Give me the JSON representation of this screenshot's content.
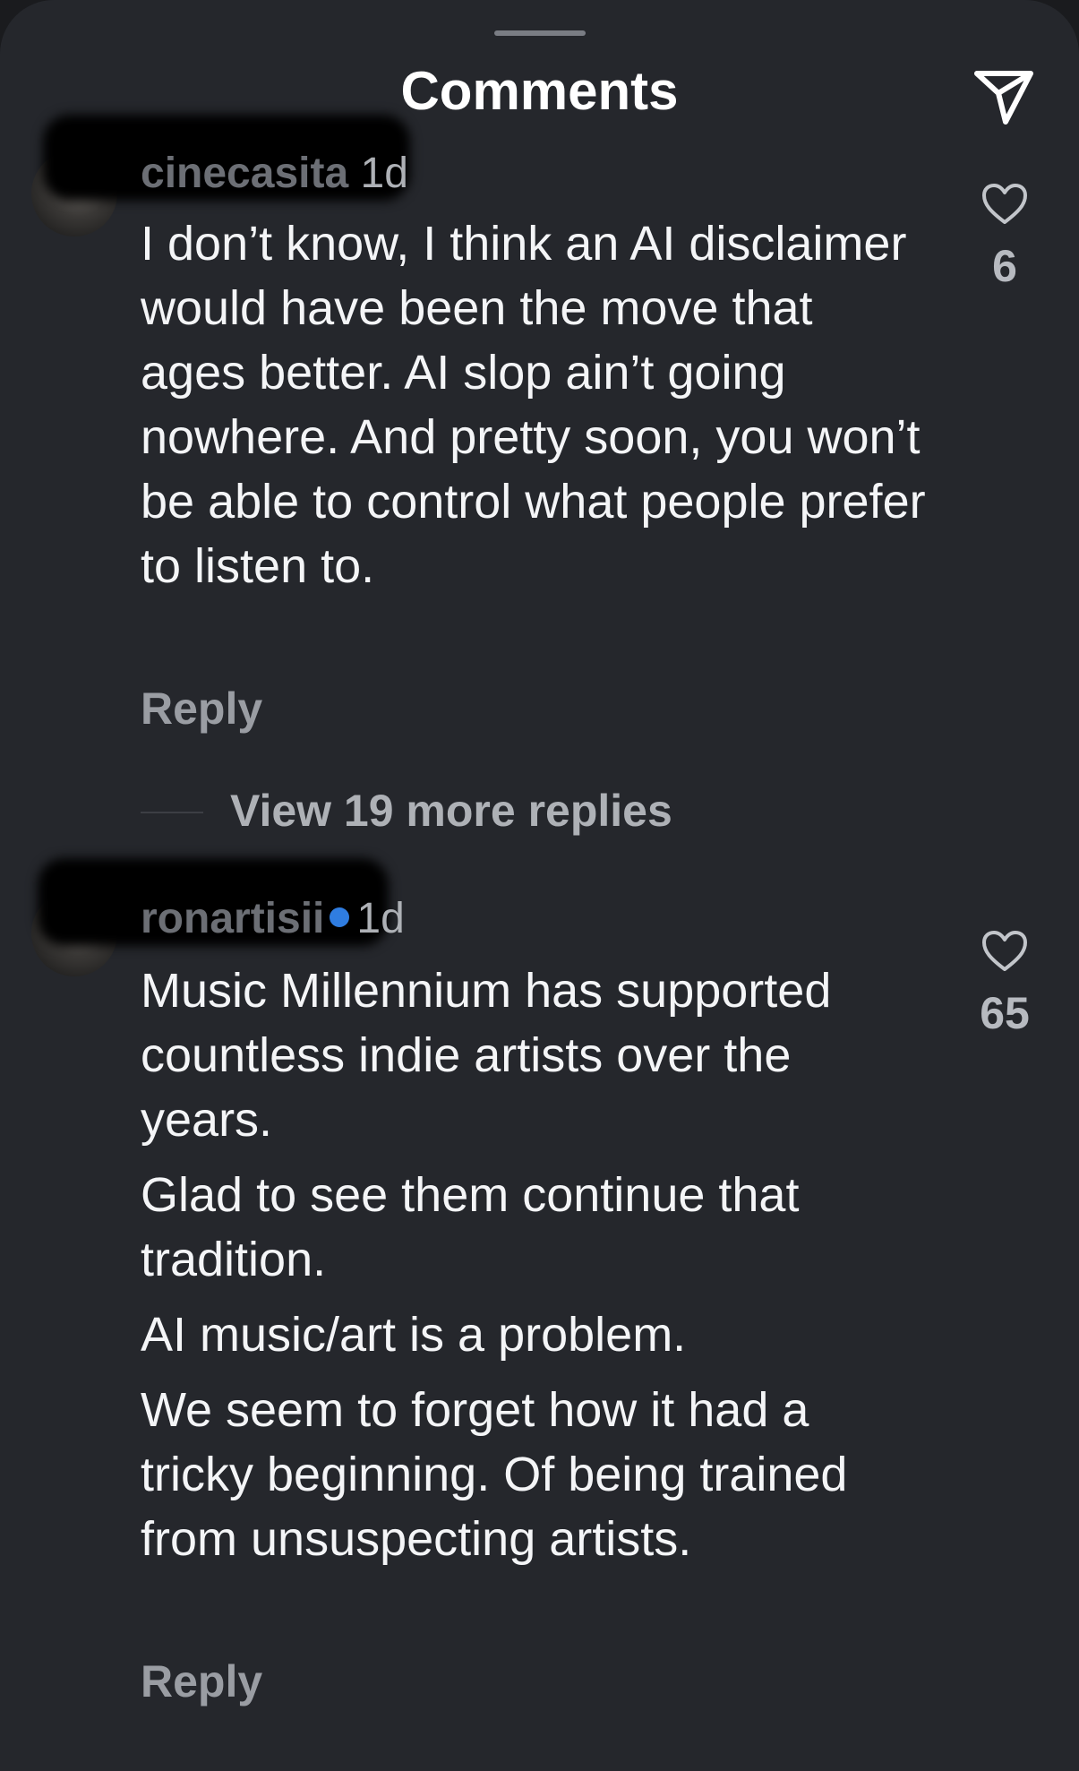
{
  "header": {
    "title": "Comments",
    "share_icon": "send-icon"
  },
  "comments": [
    {
      "username": "cinecasita",
      "time": "1d",
      "body": [
        "I don’t know, I think an AI disclaimer would have been the move that ages better. AI slop ain’t going nowhere. And pretty soon, you won’t be able to control what people prefer to listen to."
      ],
      "likes": "6",
      "reply_label": "Reply"
    },
    {
      "username": "ronartisii",
      "verified": true,
      "time": "1d",
      "body": [
        "Music Millennium has supported countless indie artists over the years.",
        "Glad to see them continue that tradition.",
        "AI music/art is a problem.",
        "We seem to forget how it had a tricky beginning. Of being trained from unsuspecting artists."
      ],
      "likes": "65",
      "reply_label": "Reply"
    }
  ],
  "view_more_replies": "View 19 more replies"
}
